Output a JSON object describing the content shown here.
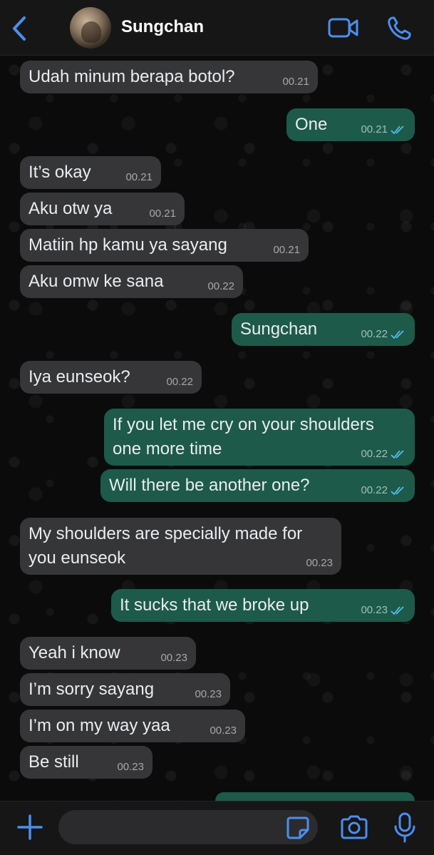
{
  "header": {
    "contact_name": "Sungchan",
    "icons": {
      "back": "chevron-left-icon",
      "video": "video-camera-icon",
      "call": "phone-icon"
    },
    "accent_color": "#4a8ff0"
  },
  "messages": [
    {
      "dir": "in",
      "text": "Udah minum berapa botol?",
      "time": "00.21"
    },
    {
      "dir": "out",
      "text": "One",
      "time": "00.21",
      "status": "read"
    },
    {
      "dir": "in",
      "text": "It’s okay",
      "time": "00.21"
    },
    {
      "dir": "in",
      "text": "Aku otw ya",
      "time": "00.21"
    },
    {
      "dir": "in",
      "text": "Matiin hp kamu ya sayang",
      "time": "00.21"
    },
    {
      "dir": "in",
      "text": "Aku omw ke sana",
      "time": "00.22"
    },
    {
      "dir": "out",
      "text": "Sungchan",
      "time": "00.22",
      "status": "read"
    },
    {
      "dir": "in",
      "text": "Iya eunseok?",
      "time": "00.22"
    },
    {
      "dir": "out",
      "line1": "If you let me cry on your shoulders",
      "line2": "one more time",
      "time": "00.22",
      "status": "read"
    },
    {
      "dir": "out",
      "text": "Will there be another one?",
      "time": "00.22",
      "status": "read"
    },
    {
      "dir": "in",
      "line1": "My shoulders are specially made for",
      "line2": "you eunseok",
      "time": "00.23"
    },
    {
      "dir": "out",
      "text": "It sucks that we broke up",
      "time": "00.23",
      "status": "read"
    },
    {
      "dir": "in",
      "text": "Yeah i know",
      "time": "00.23"
    },
    {
      "dir": "in",
      "text": "I’m sorry sayang",
      "time": "00.23"
    },
    {
      "dir": "in",
      "text": "I’m on my way yaa",
      "time": "00.23"
    },
    {
      "dir": "in",
      "text": "Be still",
      "time": "00.23"
    }
  ],
  "composer": {
    "placeholder": "",
    "icons": {
      "attach": "plus-icon",
      "sticker": "sticker-icon",
      "camera": "camera-icon",
      "mic": "microphone-icon"
    }
  },
  "colors": {
    "incoming_bubble": "#363638",
    "outgoing_bubble": "#1d5a4a",
    "read_ticks": "#53bdeb",
    "background": "#0b0b0b"
  }
}
